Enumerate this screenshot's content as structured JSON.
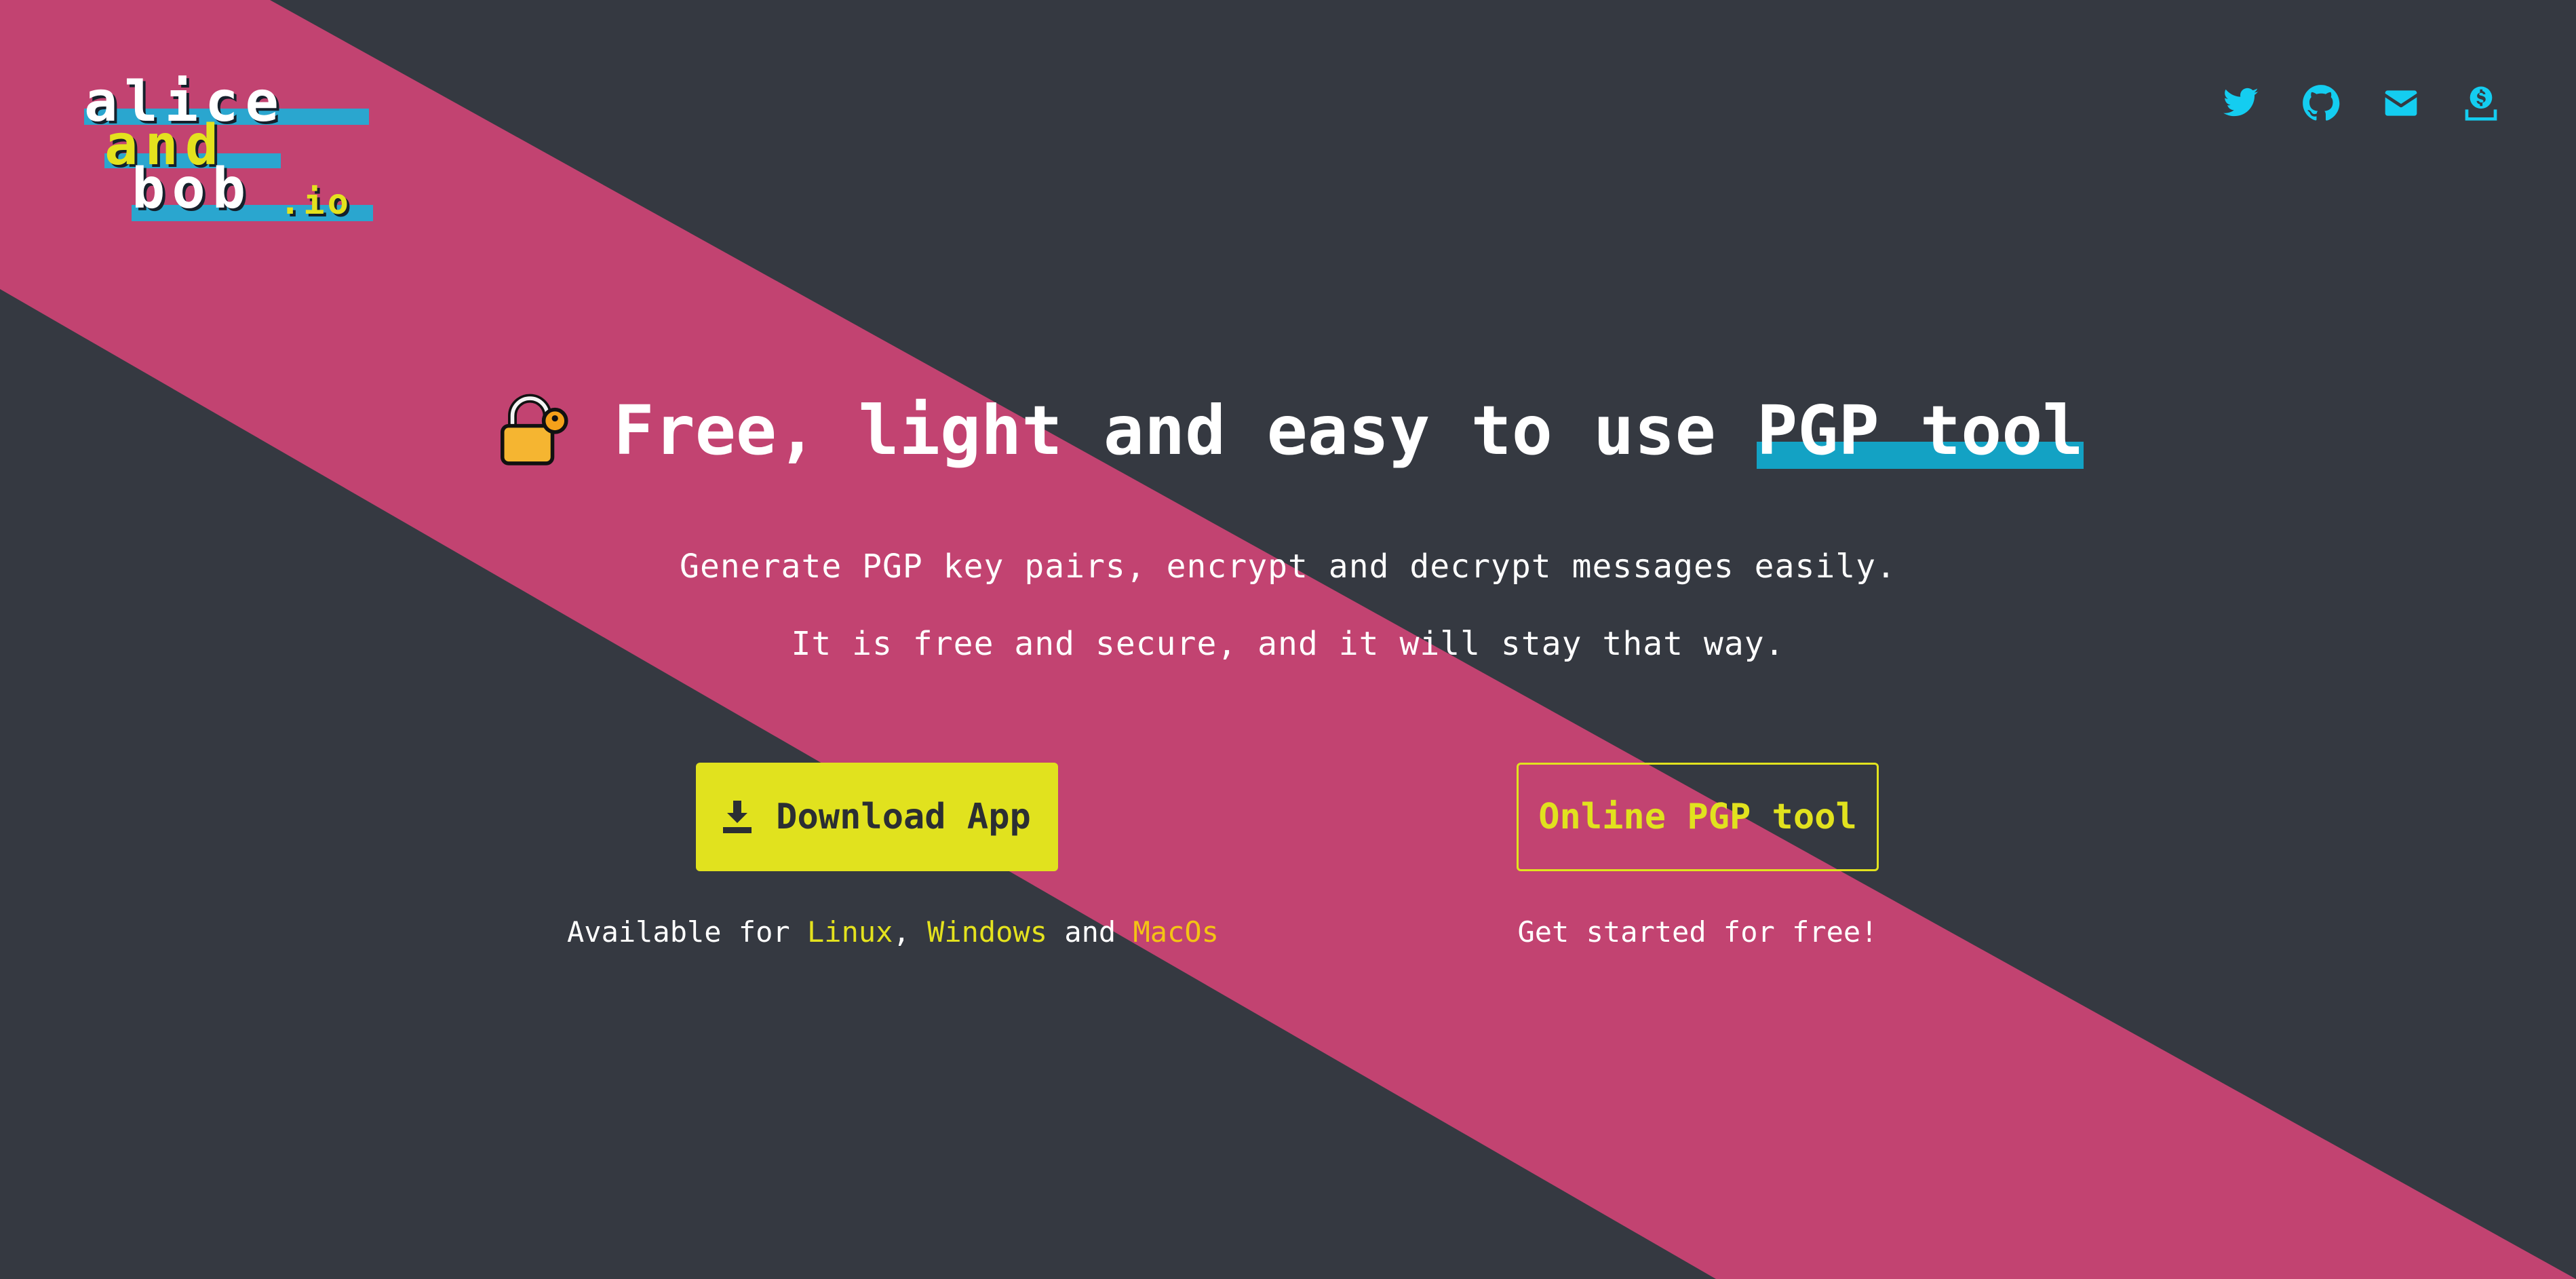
{
  "brand": {
    "logo_line1": "alice",
    "logo_line2": "and",
    "logo_line3": "bob",
    "logo_suffix": ".io"
  },
  "social": [
    {
      "name": "twitter-icon"
    },
    {
      "name": "github-icon"
    },
    {
      "name": "mail-icon"
    },
    {
      "name": "donate-icon"
    }
  ],
  "hero": {
    "title_main": "Free, light and easy to use ",
    "title_highlight": "PGP tool",
    "subtitle_1": "Generate PGP key pairs, encrypt and decrypt messages easily.",
    "subtitle_2": "It is free and secure, and it will stay that way."
  },
  "cta": {
    "download_label": "Download App",
    "online_label": "Online PGP tool",
    "available_prefix": "Available for ",
    "linux": "Linux",
    "comma": ", ",
    "windows": "Windows",
    "and": " and ",
    "macos": "MacOs",
    "get_started": "Get started for free!"
  },
  "colors": {
    "background": "#353941",
    "stripe": "#c24371",
    "accent_yellow": "#e1e21e",
    "accent_cyan": "#14cdf0",
    "highlight_blue": "#13a2c4"
  }
}
